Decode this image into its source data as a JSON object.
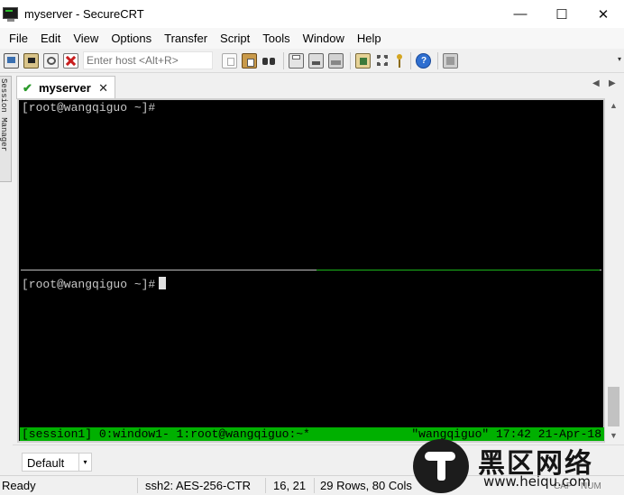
{
  "window": {
    "title": "myserver - SecureCRT",
    "minimize_icon": "minimize-icon",
    "maximize_icon": "maximize-icon",
    "close_icon": "close-icon",
    "minimize_glyph": "—",
    "maximize_glyph": "☐",
    "close_glyph": "✕"
  },
  "menu": {
    "items": [
      "File",
      "Edit",
      "View",
      "Options",
      "Transfer",
      "Script",
      "Tools",
      "Window",
      "Help"
    ]
  },
  "toolbar": {
    "quick_connect_placeholder": "Enter host <Alt+R>",
    "icons": [
      "connect-icon",
      "quick-connect-icon",
      "reconnect-icon",
      "disconnect-icon",
      "copy-icon",
      "paste-icon",
      "find-icon",
      "print-icon",
      "print-selection-icon",
      "print-setup-icon",
      "session-options-icon",
      "global-options-icon",
      "keymap-icon",
      "help-icon",
      "sftp-icon"
    ],
    "more_glyph": "▾"
  },
  "side_tab": {
    "label": "Session Manager"
  },
  "tabs": [
    {
      "label": "myserver",
      "status_icon": "connected-check-icon",
      "status_glyph": "✔",
      "close_glyph": "✕"
    }
  ],
  "tab_nav": {
    "prev_glyph": "◀",
    "next_glyph": "▶"
  },
  "terminal": {
    "top_pane_line": "[root@wangqiguo ~]#",
    "bottom_pane_line": "[root@wangqiguo ~]#",
    "tmux_status_left": "[session1] 0:window1- 1:root@wangqiguo:~*",
    "tmux_status_right": "\"wangqiguo\" 17:42 21-Apr-18"
  },
  "scrollbar": {
    "up_glyph": "▲",
    "down_glyph": "▼"
  },
  "command_bar": {
    "button_group": "Default",
    "arrow_glyph": "▾"
  },
  "status": {
    "ready": "Ready",
    "cipher": "ssh2: AES-256-CTR",
    "cursor": "16,  21",
    "size": "29 Rows, 80 Cols",
    "caps": "CAP",
    "num": "NUM"
  },
  "watermark": {
    "title": "黑区网络",
    "url": "www.heiqu.com"
  },
  "colors": {
    "terminal_bg": "#000000",
    "terminal_fg": "#c8c8c8",
    "tmux_status_bg": "#00b000",
    "active_pane_divider": "#1bb51b"
  }
}
